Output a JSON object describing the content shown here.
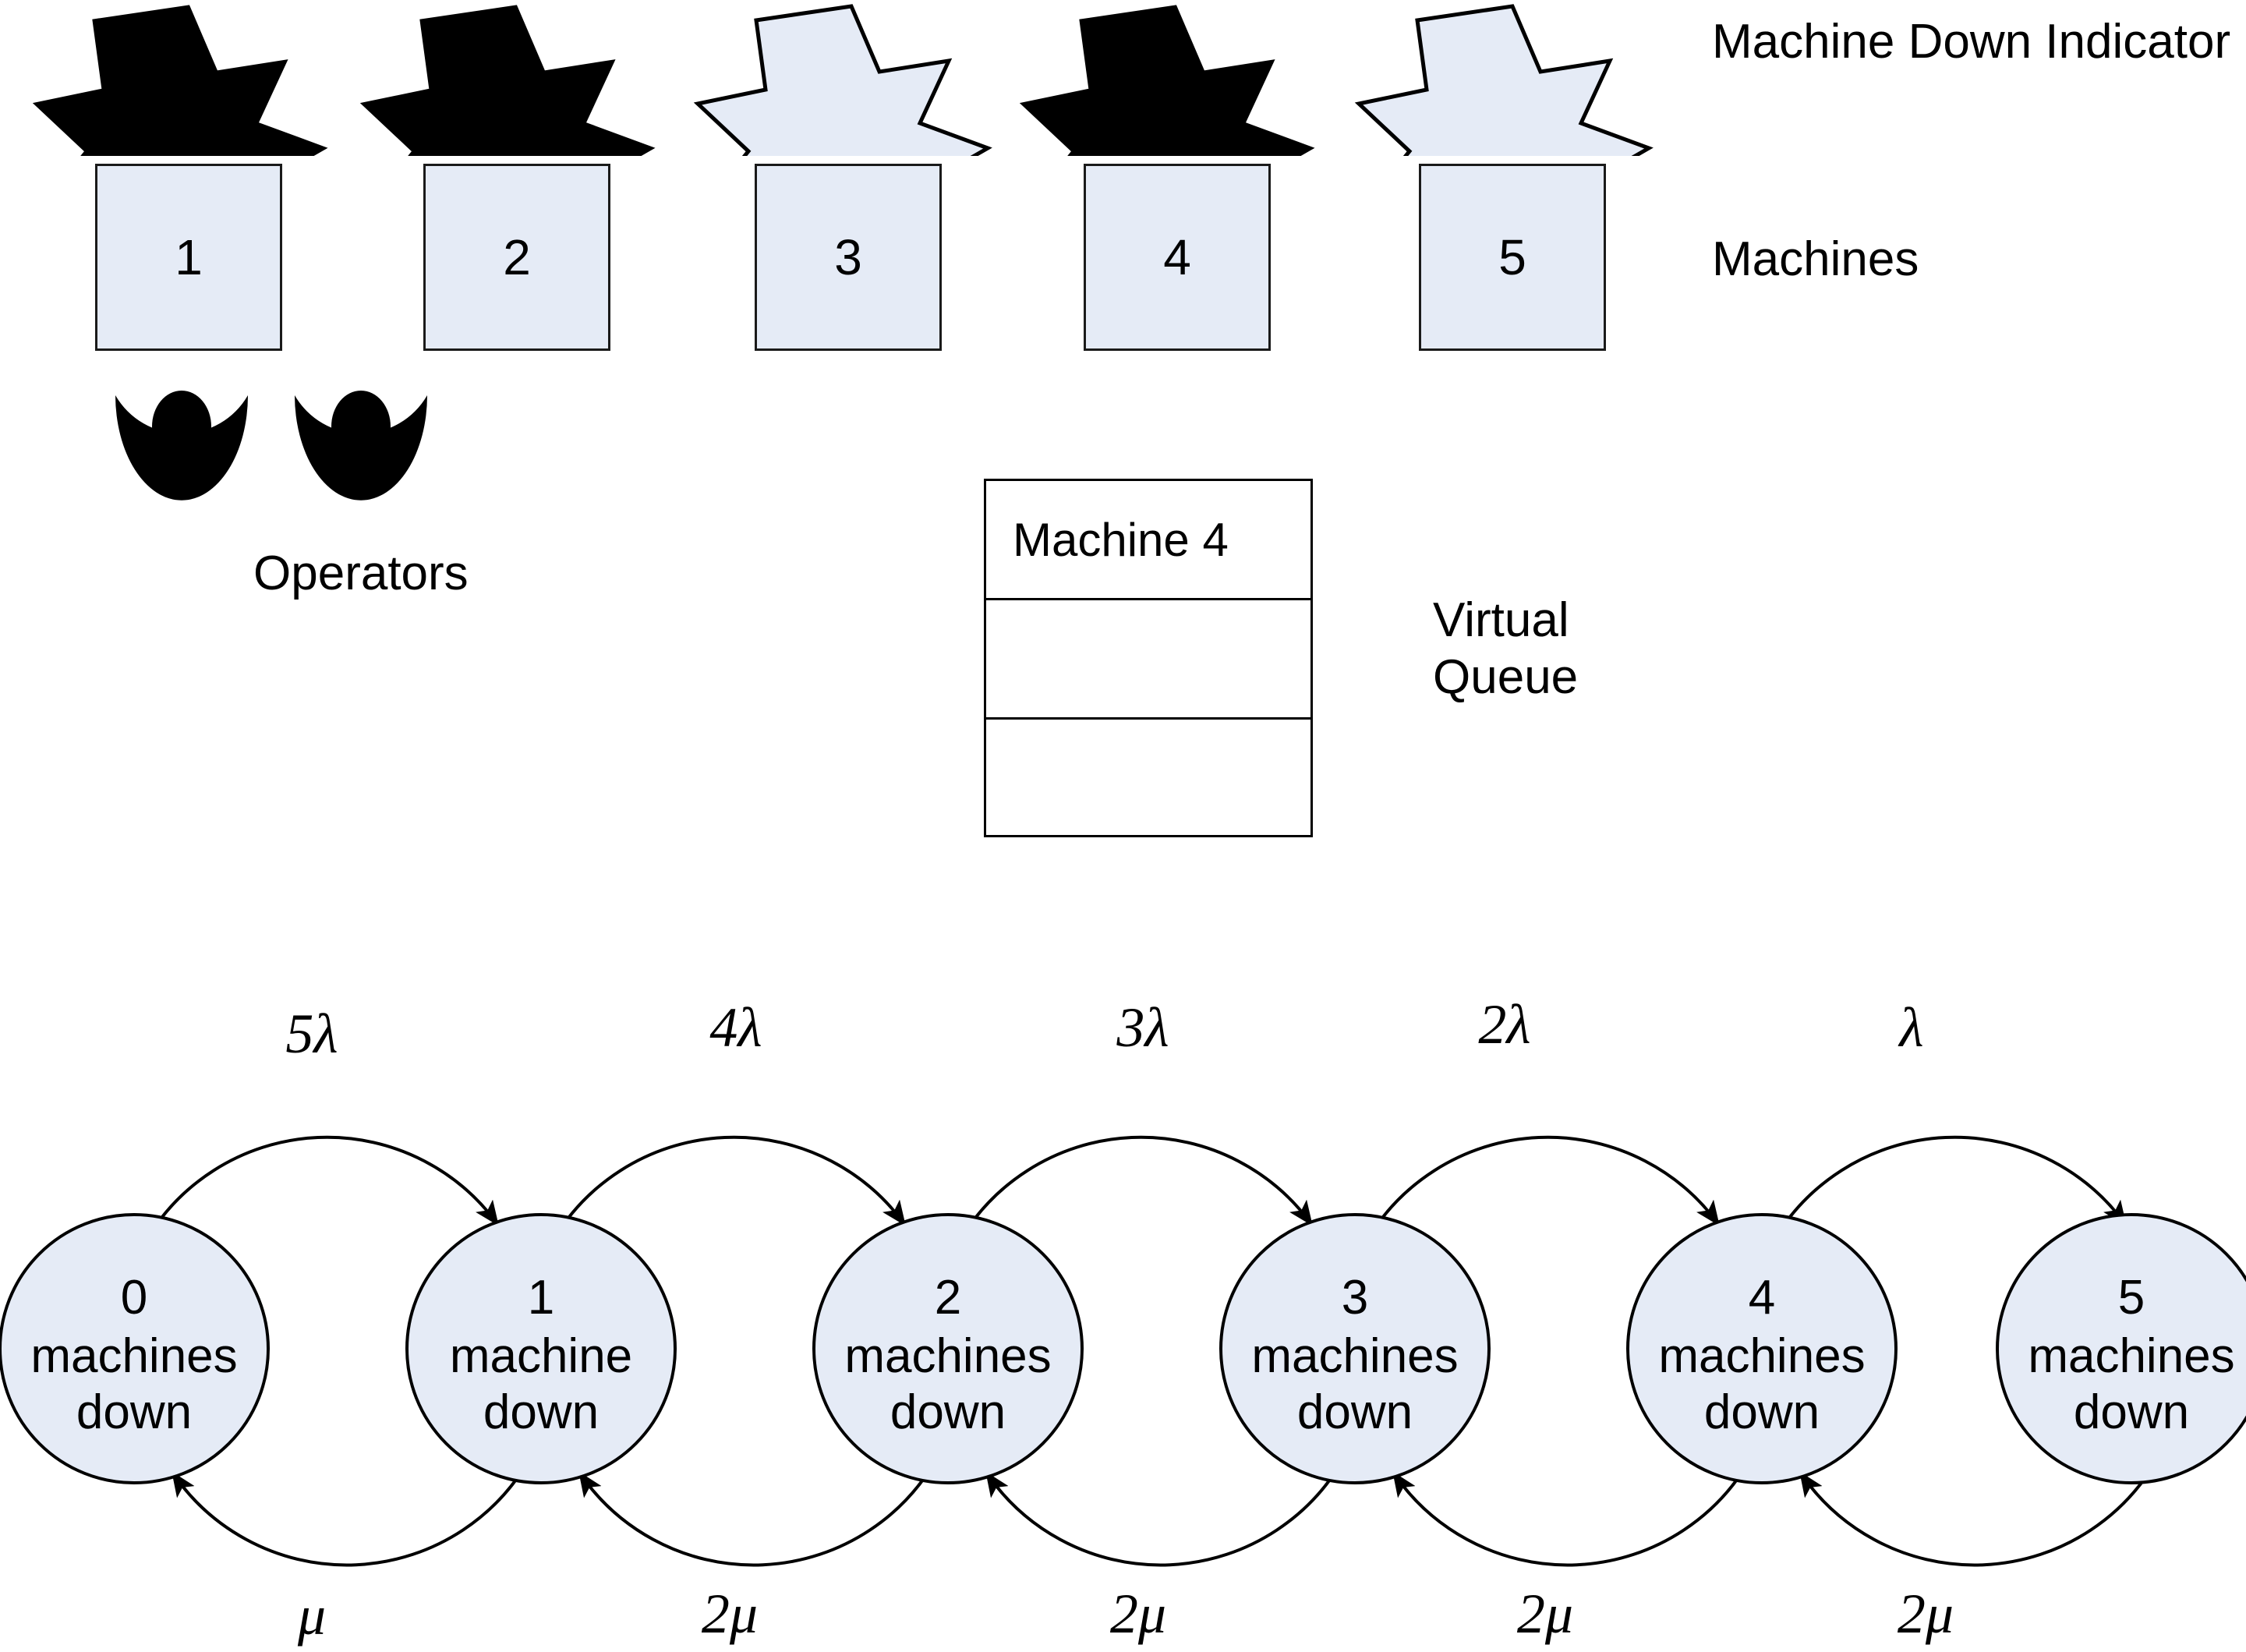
{
  "legend": {
    "indicator_label": "Machine Down Indicator",
    "machines_label": "Machines",
    "operators_label": "Operators",
    "queue_label_line1": "Virtual",
    "queue_label_line2": "Queue"
  },
  "colors": {
    "fill_light_blue": "#E5EBF6",
    "stroke_black": "#000000",
    "indicator_down": "#000000",
    "indicator_up": "#E5EBF6",
    "background": "#FFFFFF"
  },
  "machines": [
    {
      "id": "1",
      "label": "1",
      "indicator_state": "down",
      "indicator_fill": "#000000"
    },
    {
      "id": "2",
      "label": "2",
      "indicator_state": "down",
      "indicator_fill": "#000000"
    },
    {
      "id": "3",
      "label": "3",
      "indicator_state": "up",
      "indicator_fill": "#E5EBF6"
    },
    {
      "id": "4",
      "label": "4",
      "indicator_state": "down",
      "indicator_fill": "#000000"
    },
    {
      "id": "5",
      "label": "5",
      "indicator_state": "up",
      "indicator_fill": "#E5EBF6"
    }
  ],
  "operators": [
    {
      "id": "operator-1",
      "assigned_machine": "1"
    },
    {
      "id": "operator-2",
      "assigned_machine": "2"
    }
  ],
  "virtual_queue": {
    "slots": [
      {
        "text": "Machine 4"
      },
      {
        "text": ""
      },
      {
        "text": ""
      }
    ]
  },
  "chart_data": {
    "type": "diagram",
    "subtype": "markov-state-transition",
    "title": "",
    "states": [
      {
        "index": 0,
        "line1": "0",
        "line2": "machines",
        "line3": "down"
      },
      {
        "index": 1,
        "line1": "1",
        "line2": "machine",
        "line3": "down"
      },
      {
        "index": 2,
        "line1": "2",
        "line2": "machines",
        "line3": "down"
      },
      {
        "index": 3,
        "line1": "3",
        "line2": "machines",
        "line3": "down"
      },
      {
        "index": 4,
        "line1": "4",
        "line2": "machines",
        "line3": "down"
      },
      {
        "index": 5,
        "line1": "5",
        "line2": "machines",
        "line3": "down"
      }
    ],
    "transitions_forward": [
      {
        "from": 0,
        "to": 1,
        "rate": "5λ"
      },
      {
        "from": 1,
        "to": 2,
        "rate": "4λ"
      },
      {
        "from": 2,
        "to": 3,
        "rate": "3λ"
      },
      {
        "from": 3,
        "to": 4,
        "rate": "2λ"
      },
      {
        "from": 4,
        "to": 5,
        "rate": "λ"
      }
    ],
    "transitions_backward": [
      {
        "from": 1,
        "to": 0,
        "rate": "μ"
      },
      {
        "from": 2,
        "to": 1,
        "rate": "2μ"
      },
      {
        "from": 3,
        "to": 2,
        "rate": "2μ"
      },
      {
        "from": 4,
        "to": 3,
        "rate": "2μ"
      },
      {
        "from": 5,
        "to": 4,
        "rate": "2μ"
      }
    ],
    "node_fill": "#E5EBF6",
    "node_stroke": "#000000"
  }
}
